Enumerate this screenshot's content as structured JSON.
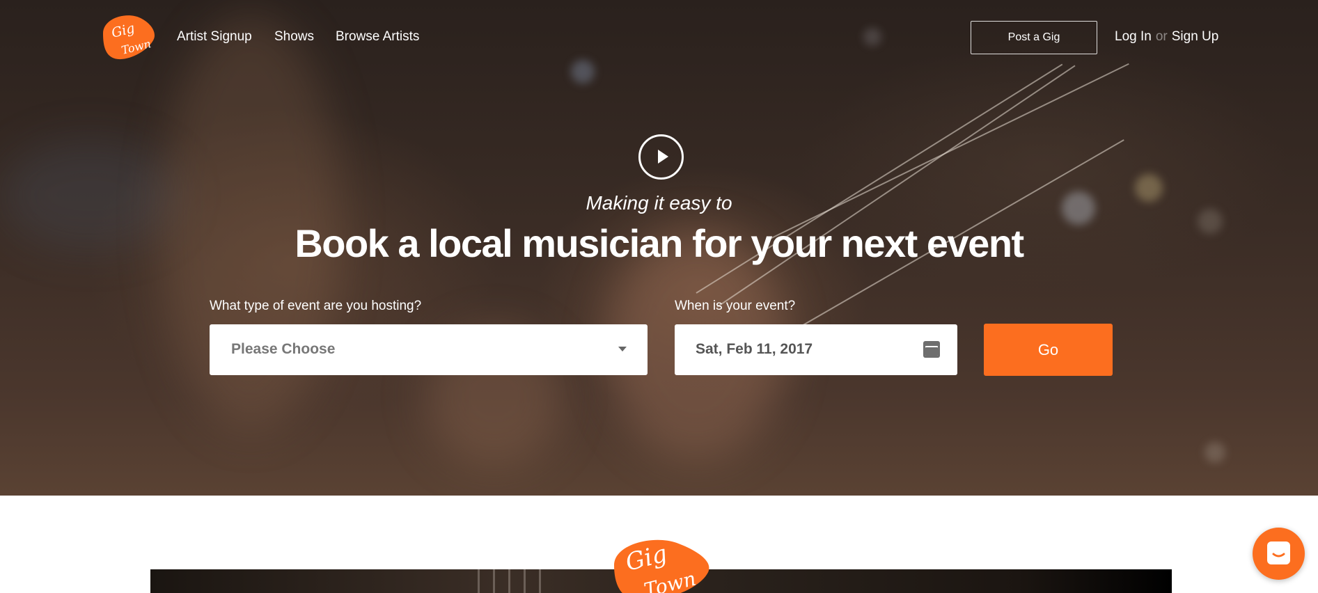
{
  "brand": {
    "name": "Gig Town",
    "color": "#fc6e1f"
  },
  "nav": {
    "links": [
      "Artist Signup",
      "Shows",
      "Browse Artists"
    ],
    "post_gig": "Post a Gig",
    "login": "Log In",
    "or": "or",
    "signup": "Sign Up"
  },
  "hero": {
    "tagline": "Making it easy to",
    "headline": "Book a local musician for your next event",
    "event_type_label": "What type of event are you hosting?",
    "event_type_value": "Please Choose",
    "date_label": "When is your event?",
    "date_value": "Sat, Feb 11, 2017",
    "go_label": "Go"
  },
  "icons": {
    "play": "play-icon",
    "calendar": "calendar-icon",
    "chevron": "chevron-down-icon",
    "chat": "chat-icon"
  }
}
